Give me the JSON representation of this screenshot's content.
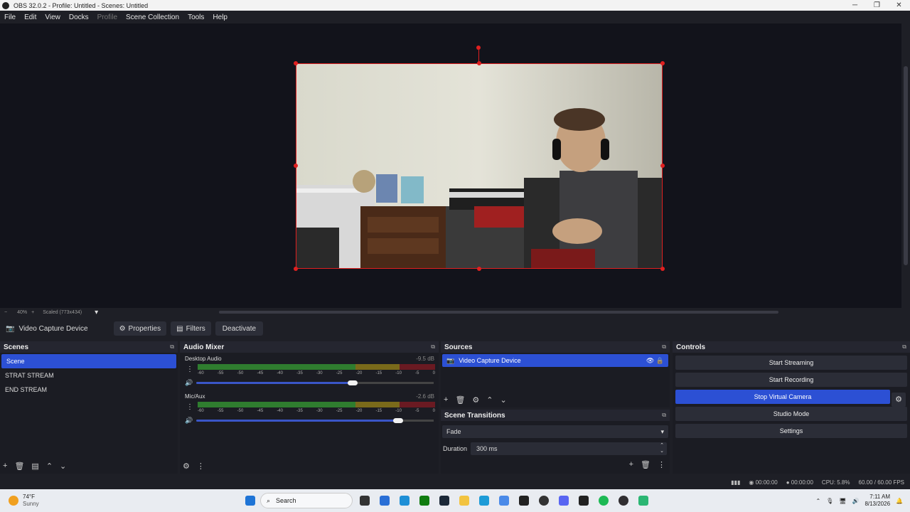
{
  "window": {
    "title": "OBS 32.0.2 - Profile: Untitled - Scenes: Untitled",
    "minimize": "─",
    "maximize": "❐",
    "close": "✕"
  },
  "menu": [
    "File",
    "Edit",
    "View",
    "Docks",
    "Profile",
    "Scene Collection",
    "Tools",
    "Help"
  ],
  "zoom": {
    "minus": "−",
    "level": "40%",
    "plus": "+",
    "scale": "Scaled (773x434)",
    "dropdown": "▾"
  },
  "source_toolbar": {
    "source_name": "Video Capture Device",
    "properties": "Properties",
    "filters": "Filters",
    "deactivate": "Deactivate"
  },
  "scenes": {
    "title": "Scenes",
    "items": [
      "Scene",
      "STRAT STREAM",
      "END STREAM"
    ],
    "selected": 0
  },
  "audio_mixer": {
    "title": "Audio Mixer",
    "ticks": [
      "-60",
      "-55",
      "-50",
      "-45",
      "-40",
      "-35",
      "-30",
      "-25",
      "-20",
      "-15",
      "-10",
      "-5",
      "0"
    ],
    "channels": [
      {
        "name": "Desktop Audio",
        "db": "-9.5 dB",
        "volume": 0.66
      },
      {
        "name": "Mic/Aux",
        "db": "-2.6 dB",
        "volume": 0.85
      }
    ]
  },
  "sources": {
    "title": "Sources",
    "items": [
      {
        "name": "Video Capture Device",
        "visible": true,
        "locked": true
      }
    ]
  },
  "transitions": {
    "title": "Scene Transitions",
    "selected": "Fade",
    "duration_label": "Duration",
    "duration_value": "300 ms"
  },
  "controls": {
    "title": "Controls",
    "buttons": [
      "Start Streaming",
      "Start Recording",
      "Stop Virtual Camera",
      "Studio Mode",
      "Settings"
    ],
    "active": "Stop Virtual Camera"
  },
  "status": {
    "stream_time": "00:00:00",
    "rec_time": "00:00:00",
    "cpu": "CPU: 5.8%",
    "fps": "60.00 / 60.00 FPS"
  },
  "taskbar": {
    "weather_temp": "74°F",
    "weather_desc": "Sunny",
    "search": "Search",
    "time": "7:11 AM",
    "date": "8/13/2026"
  },
  "colors": {
    "accent": "#2c50d4",
    "selection_red": "#e02020",
    "meter_green": "#2f7d2f",
    "meter_yellow": "#7a6a1a",
    "meter_red": "#6a1a22"
  }
}
